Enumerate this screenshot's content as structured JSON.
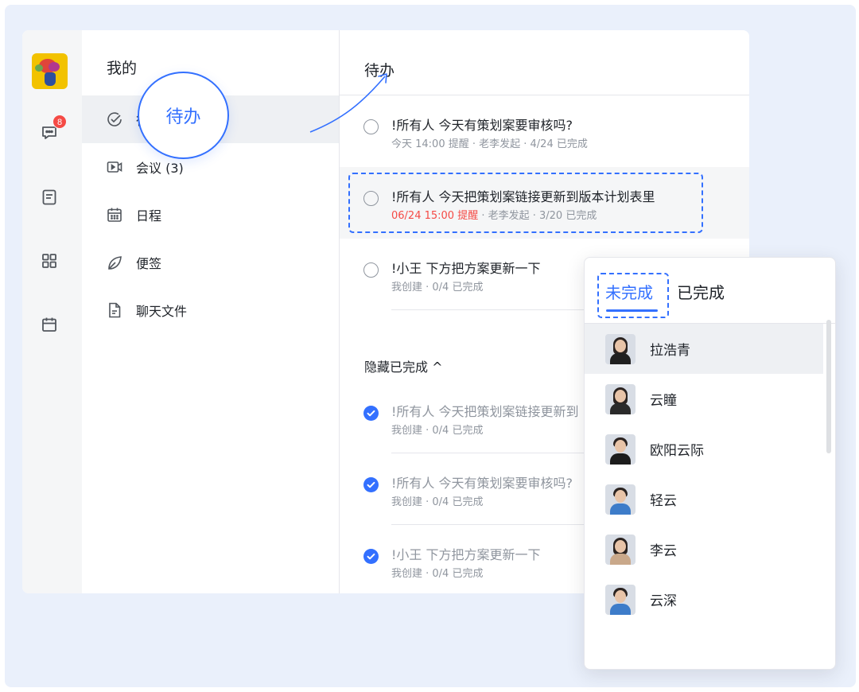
{
  "rail": {
    "badge_count": "8",
    "icons": [
      "app-avatar",
      "chat-icon",
      "doc-icon",
      "grid-icon",
      "calendar-icon"
    ]
  },
  "sidebar": {
    "title": "我的",
    "items": [
      {
        "label": "待办",
        "icon": "todo-check-icon",
        "active": true
      },
      {
        "label": "会议 (3)",
        "icon": "video-meeting-icon"
      },
      {
        "label": "日程",
        "icon": "calendar-icon"
      },
      {
        "label": "便签",
        "icon": "leaf-note-icon"
      },
      {
        "label": "聊天文件",
        "icon": "file-icon"
      }
    ]
  },
  "callout": {
    "label": "待办"
  },
  "main": {
    "title": "待办",
    "pending": [
      {
        "title": "!所有人 今天有策划案要审核吗?",
        "meta": "今天 14:00 提醒 · 老李发起 · 4/24 已完成"
      },
      {
        "title": "!所有人 今天把策划案链接更新到版本计划表里",
        "meta_red": "06/24 15:00 提醒",
        "meta": " · 老李发起 · 3/20 已完成"
      },
      {
        "title": "!小王 下方把方案更新一下",
        "meta": "我创建 · 0/4 已完成"
      }
    ],
    "hide_completed_label": "隐藏已完成 ^",
    "completed": [
      {
        "title": "!所有人 今天把策划案链接更新到",
        "meta": "我创建 · 0/4 已完成"
      },
      {
        "title": "!所有人 今天有策划案要审核吗?",
        "meta": "我创建 · 0/4 已完成"
      },
      {
        "title": "!小王 下方把方案更新一下",
        "meta": "我创建 · 0/4 已完成"
      }
    ]
  },
  "popup": {
    "tab_active": "未完成",
    "tab_inactive": "已完成",
    "people": [
      {
        "name": "拉浩青",
        "gender": "f",
        "shirt": "#1f1f1f"
      },
      {
        "name": "云瞳",
        "gender": "f",
        "shirt": "#2a2a2a"
      },
      {
        "name": "欧阳云际",
        "gender": "m",
        "shirt": "#1c1c1c"
      },
      {
        "name": "轻云",
        "gender": "m",
        "shirt": "#3d7cc9"
      },
      {
        "name": "李云",
        "gender": "f",
        "shirt": "#c9a88a"
      },
      {
        "name": "云深",
        "gender": "m",
        "shirt": "#3d7cc9"
      }
    ]
  },
  "colors": {
    "accent": "#3370ff",
    "danger": "#f54a45",
    "stage_bg": "#eaf0fb"
  }
}
